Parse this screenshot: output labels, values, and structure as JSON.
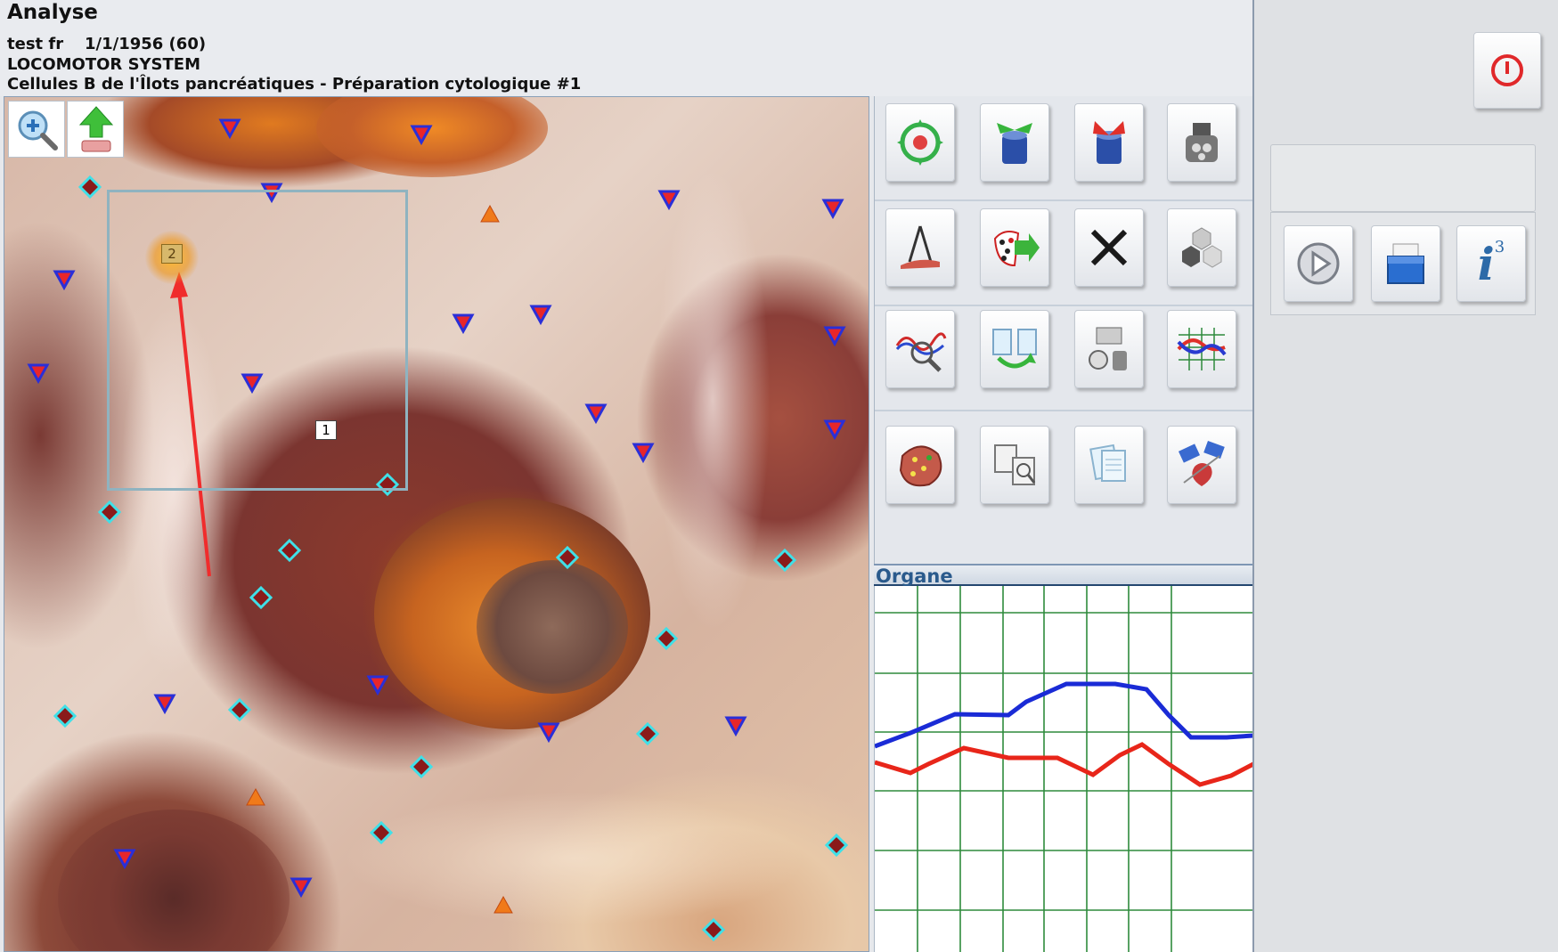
{
  "header": {
    "app_title": "Analyse",
    "patient_name": "test  fr",
    "patient_dob": "1/1/1956 (60)",
    "system": "LOCOMOTOR SYSTEM",
    "preparation": "Cellules B de l'Îlots pancréatiques - Préparation cytologique #1"
  },
  "image_panel": {
    "point_labels": [
      "1",
      "2"
    ],
    "toolbar_icons": [
      "zoom-in-icon",
      "upload-icon"
    ]
  },
  "tools": {
    "rows": [
      [
        "target-icon",
        "barrel-arrows-out-icon",
        "barrel-arrows-in-icon",
        "machine-icon"
      ],
      [
        "compass-icon",
        "dots-arrow-icon",
        "close-icon",
        "hexagons-icon"
      ],
      [
        "wave-magnifier-icon",
        "documents-exchange-icon",
        "film-drum-icon",
        "graph-lines-icon"
      ],
      [
        "organ-spots-icon",
        "document-search-icon",
        "notes-icon",
        "heart-satellite-icon"
      ]
    ]
  },
  "organ_panel": {
    "title": "Organe",
    "series_colors": {
      "blue": "#1a2bd6",
      "red": "#e8261a"
    },
    "grid_color": "#2e8a3c"
  },
  "right_panel": {
    "buttons": [
      "power-icon",
      "play-icon",
      "folder-icon",
      "info-icon"
    ],
    "info_label": "i",
    "info_sup": "3"
  }
}
